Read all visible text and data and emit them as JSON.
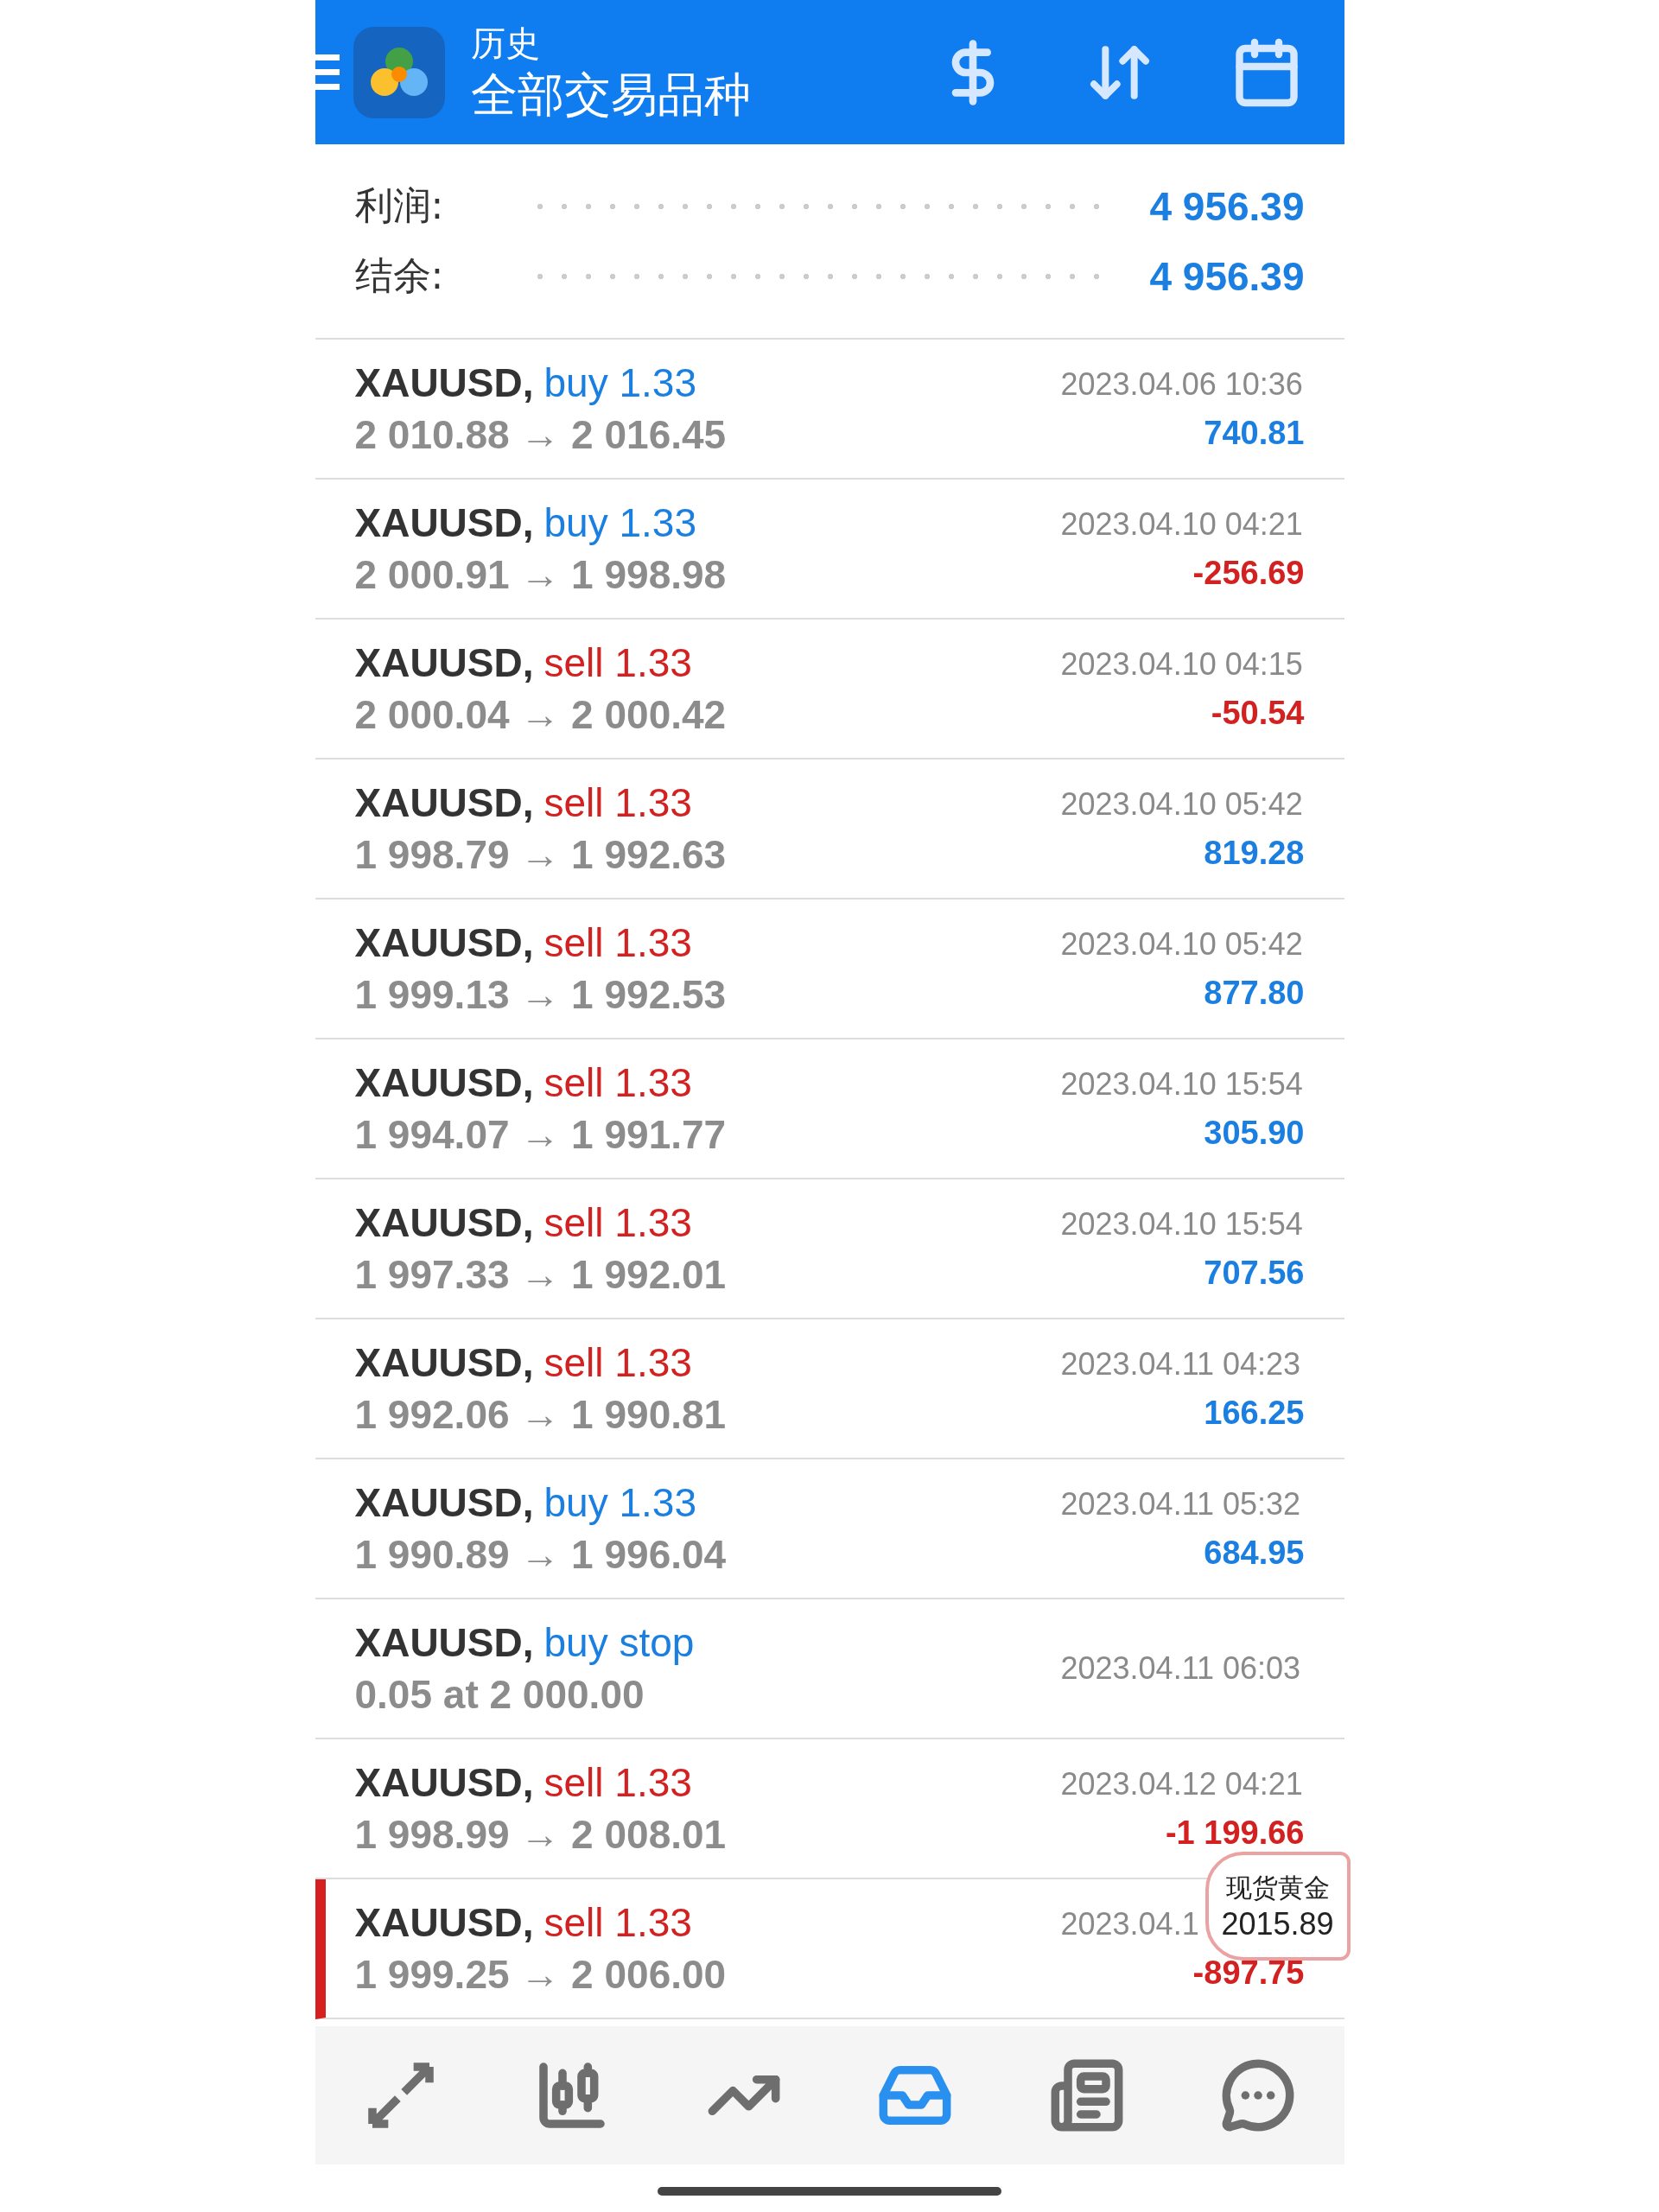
{
  "header": {
    "title": "历史",
    "subtitle": "全部交易品种"
  },
  "summary": [
    {
      "label": "利润:",
      "value": "4 956.39"
    },
    {
      "label": "结余:",
      "value": "4 956.39"
    }
  ],
  "deals": [
    {
      "symbol": "XAUUSD,",
      "kind": "buy",
      "order": "buy 1.33",
      "prices": "2 010.88 → 2 016.45",
      "time": "2023.04.06 10:36",
      "profit": "740.81",
      "loss": false,
      "marked": false
    },
    {
      "symbol": "XAUUSD,",
      "kind": "buy",
      "order": "buy 1.33",
      "prices": "2 000.91 → 1 998.98",
      "time": "2023.04.10 04:21",
      "profit": "-256.69",
      "loss": true,
      "marked": false
    },
    {
      "symbol": "XAUUSD,",
      "kind": "sell",
      "order": "sell 1.33",
      "prices": "2 000.04 → 2 000.42",
      "time": "2023.04.10 04:15",
      "profit": "-50.54",
      "loss": true,
      "marked": false
    },
    {
      "symbol": "XAUUSD,",
      "kind": "sell",
      "order": "sell 1.33",
      "prices": "1 998.79 → 1 992.63",
      "time": "2023.04.10 05:42",
      "profit": "819.28",
      "loss": false,
      "marked": false
    },
    {
      "symbol": "XAUUSD,",
      "kind": "sell",
      "order": "sell 1.33",
      "prices": "1 999.13 → 1 992.53",
      "time": "2023.04.10 05:42",
      "profit": "877.80",
      "loss": false,
      "marked": false
    },
    {
      "symbol": "XAUUSD,",
      "kind": "sell",
      "order": "sell 1.33",
      "prices": "1 994.07 → 1 991.77",
      "time": "2023.04.10 15:54",
      "profit": "305.90",
      "loss": false,
      "marked": false
    },
    {
      "symbol": "XAUUSD,",
      "kind": "sell",
      "order": "sell 1.33",
      "prices": "1 997.33 → 1 992.01",
      "time": "2023.04.10 15:54",
      "profit": "707.56",
      "loss": false,
      "marked": false
    },
    {
      "symbol": "XAUUSD,",
      "kind": "sell",
      "order": "sell 1.33",
      "prices": "1 992.06 → 1 990.81",
      "time": "2023.04.11 04:23",
      "profit": "166.25",
      "loss": false,
      "marked": false
    },
    {
      "symbol": "XAUUSD,",
      "kind": "buy",
      "order": "buy 1.33",
      "prices": "1 990.89 → 1 996.04",
      "time": "2023.04.11 05:32",
      "profit": "684.95",
      "loss": false,
      "marked": false
    },
    {
      "symbol": "XAUUSD,",
      "kind": "buy",
      "order": "buy stop",
      "prices": "0.05 at 2 000.00",
      "time": "2023.04.11 06:03",
      "marked": false
    },
    {
      "symbol": "XAUUSD,",
      "kind": "sell",
      "order": "sell 1.33",
      "prices": "1 998.99 → 2 008.01",
      "time": "2023.04.12 04:21",
      "profit": "-1 199.66",
      "loss": true,
      "marked": false
    },
    {
      "symbol": "XAUUSD,",
      "kind": "sell",
      "order": "sell 1.33",
      "prices": "1 999.25 → 2 006.00",
      "time": "2023.04.1",
      "profit": "-897.75",
      "loss": true,
      "marked": true
    }
  ],
  "price_bubble": {
    "label": "现货黄金",
    "price": "2015.89"
  },
  "nav": [
    {
      "kind": "trade",
      "selected": false
    },
    {
      "kind": "quotes",
      "selected": false
    },
    {
      "kind": "chart",
      "selected": false
    },
    {
      "kind": "history",
      "selected": true
    },
    {
      "kind": "news",
      "selected": false
    },
    {
      "kind": "chat",
      "selected": false
    }
  ]
}
